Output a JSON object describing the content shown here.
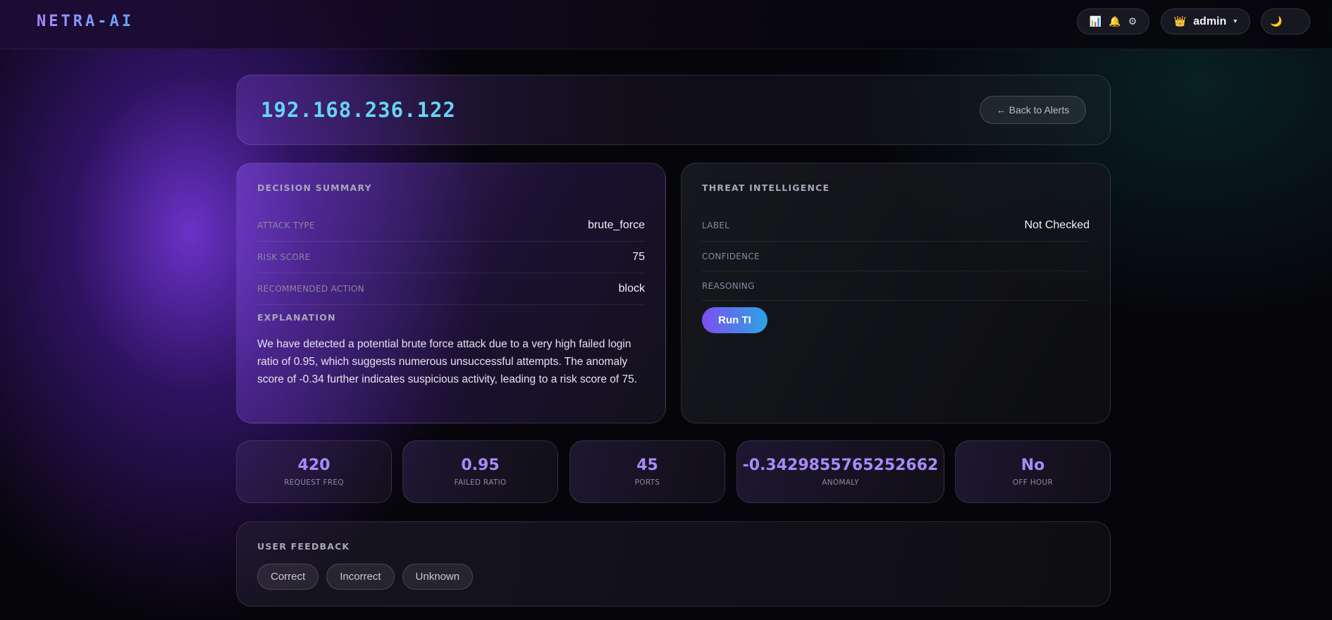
{
  "app": {
    "logo": "NETRA-AI"
  },
  "topbar": {
    "icons": [
      "chart-icon",
      "bell-icon",
      "gear-icon"
    ],
    "user": {
      "icon": "crown-icon",
      "name": "admin",
      "caret": "▾"
    },
    "theme": {
      "icon": "moon-icon"
    }
  },
  "header": {
    "ip": "192.168.236.122",
    "back_label": "← Back to Alerts"
  },
  "decision": {
    "title": "DECISION SUMMARY",
    "rows": [
      {
        "key": "ATTACK TYPE",
        "value": "brute_force"
      },
      {
        "key": "RISK SCORE",
        "value": "75"
      },
      {
        "key": "RECOMMENDED ACTION",
        "value": "block"
      }
    ],
    "explanation_title": "EXPLANATION",
    "explanation": "We have detected a potential brute force attack due to a very high failed login ratio of 0.95, which suggests numerous unsuccessful attempts. The anomaly score of -0.34 further indicates suspicious activity, leading to a risk score of 75."
  },
  "threat": {
    "title": "THREAT INTELLIGENCE",
    "rows": [
      {
        "key": "LABEL",
        "value": "Not Checked"
      },
      {
        "key": "CONFIDENCE",
        "value": ""
      },
      {
        "key": "REASONING",
        "value": ""
      }
    ],
    "run_label": "Run TI"
  },
  "stats": [
    {
      "value": "420",
      "label": "REQUEST FREQ"
    },
    {
      "value": "0.95",
      "label": "FAILED RATIO"
    },
    {
      "value": "45",
      "label": "PORTS"
    },
    {
      "value": "-0.3429855765252662",
      "label": "ANOMALY"
    },
    {
      "value": "No",
      "label": "OFF HOUR"
    }
  ],
  "feedback": {
    "title": "USER FEEDBACK",
    "buttons": [
      "Correct",
      "Incorrect",
      "Unknown"
    ]
  }
}
